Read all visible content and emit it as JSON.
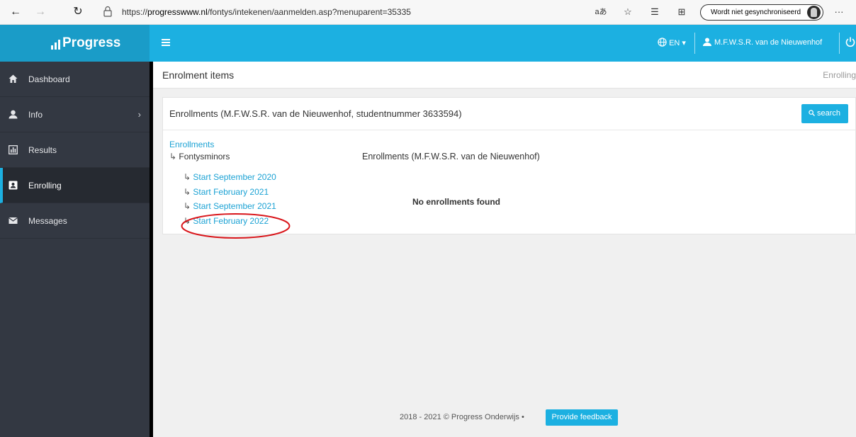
{
  "browser": {
    "url_prefix": "https://",
    "url_host": "progresswww.nl",
    "url_path": "/fontys/intekenen/aanmelden.asp?menuparent=35335",
    "read_aloud_label": "aあ",
    "sync_label": "Wordt niet gesynchroniseerd",
    "more_label": "···"
  },
  "topbar": {
    "brand": "Progress",
    "language": "EN",
    "user_name": "M.F.W.S.R. van de Nieuwenhof"
  },
  "sidebar": {
    "items": [
      {
        "label": "Dashboard",
        "icon": "home-icon"
      },
      {
        "label": "Info",
        "icon": "user-icon"
      },
      {
        "label": "Results",
        "icon": "results-icon"
      },
      {
        "label": "Enrolling",
        "icon": "badge-icon"
      },
      {
        "label": "Messages",
        "icon": "envelope-icon"
      }
    ]
  },
  "page": {
    "title": "Enrolment items",
    "breadcrumb": "Enrolling"
  },
  "card": {
    "title": "Enrollments (M.F.W.S.R. van de Nieuwenhof, studentnummer 3633594)",
    "search_label": "search",
    "tree_root": "Enrollments",
    "tree_group": "Fontysminors",
    "tree_items": [
      "Start September 2020",
      "Start February 2021",
      "Start September 2021",
      "Start February 2022"
    ],
    "results_title": "Enrollments (M.F.W.S.R. van de Nieuwenhof)",
    "empty_message": "No enrollments found"
  },
  "footer": {
    "copyright": "2018 - 2021 © Progress Onderwijs •",
    "feedback_label": "Provide feedback"
  },
  "colors": {
    "accent": "#1cb0e1",
    "sidebar": "#333842",
    "annotation": "#d9161b"
  }
}
